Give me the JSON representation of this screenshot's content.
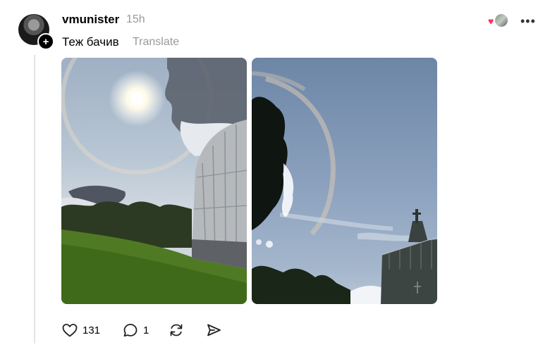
{
  "post": {
    "username": "vmunister",
    "timestamp": "15h",
    "text": "Теж бачив",
    "translate_label": "Translate"
  },
  "icons": {
    "follow": "plus-icon",
    "reaction": "heart-icon",
    "more": "more-horizontal-icon",
    "like": "heart-outline-icon",
    "reply": "comment-icon",
    "repost": "repost-icon",
    "share": "send-icon"
  },
  "stats": {
    "likes": "131",
    "replies": "1"
  },
  "colors": {
    "reaction_heart": "#ff2d55",
    "muted_text": "#999999"
  }
}
